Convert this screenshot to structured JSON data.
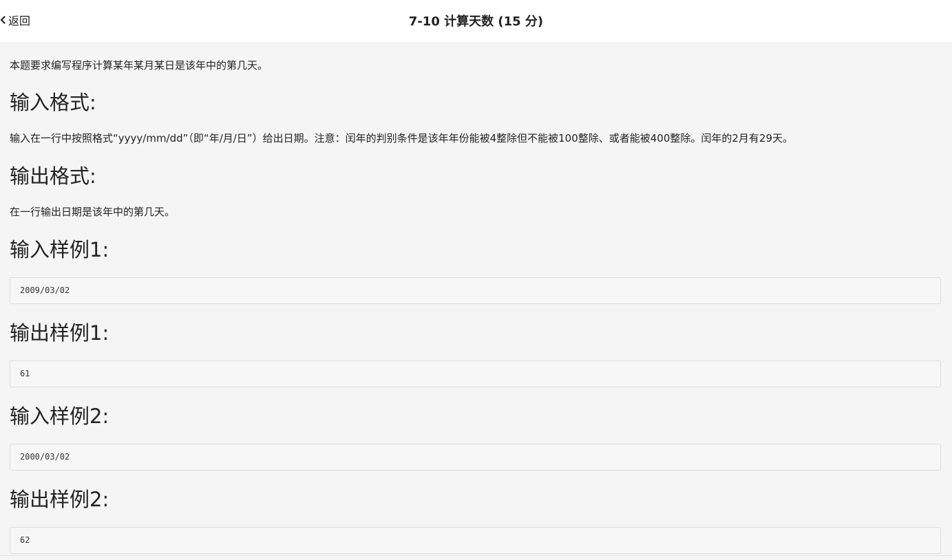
{
  "header": {
    "back_label": "返回",
    "title": "7-10 计算天数 (15 分)"
  },
  "problem": {
    "description": "本题要求编写程序计算某年某月某日是该年中的第几天。",
    "input_format_heading": "输入格式:",
    "input_format_text": "输入在一行中按照格式“yyyy/mm/dd”（即“年/月/日”）给出日期。注意：闰年的判别条件是该年年份能被4整除但不能被100整除、或者能被400整除。闰年的2月有29天。",
    "output_format_heading": "输出格式:",
    "output_format_text": "在一行输出日期是该年中的第几天。",
    "samples": [
      {
        "heading": "输入样例1:",
        "value": "2009/03/02"
      },
      {
        "heading": "输出样例1:",
        "value": "61"
      },
      {
        "heading": "输入样例2:",
        "value": "2000/03/02"
      },
      {
        "heading": "输出样例2:",
        "value": "62"
      }
    ]
  }
}
